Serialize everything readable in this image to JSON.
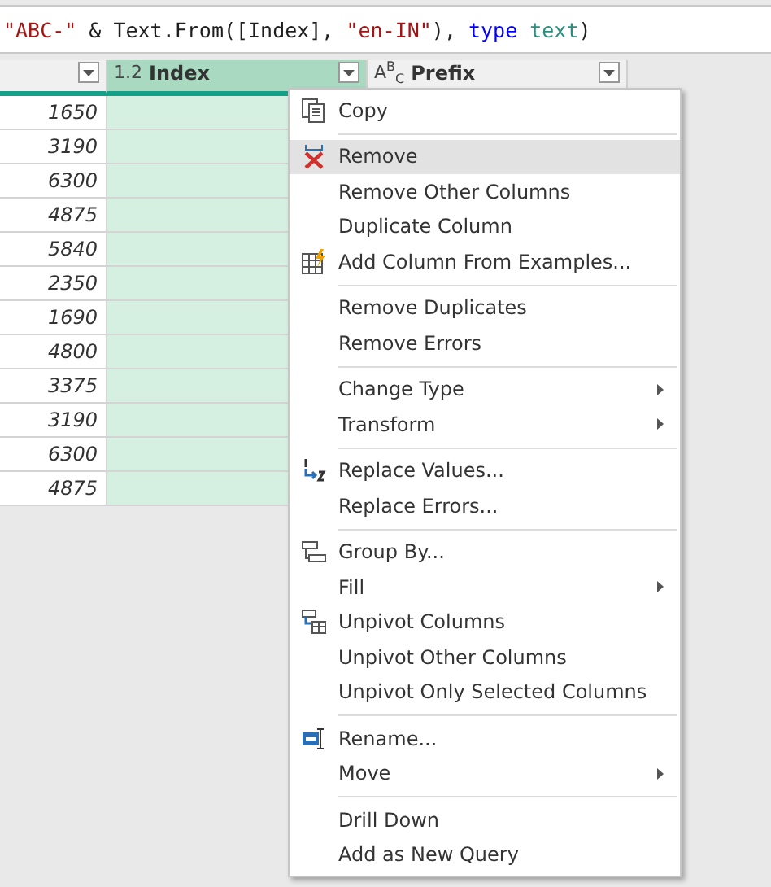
{
  "formula_bar": {
    "parts": [
      {
        "kind": "string",
        "text": "\"ABC-\""
      },
      {
        "kind": "plain",
        "text": " & Text.From([Index], "
      },
      {
        "kind": "string",
        "text": "\"en-IN\""
      },
      {
        "kind": "plain",
        "text": "), "
      },
      {
        "kind": "keyword",
        "text": "type"
      },
      {
        "kind": "type",
        "text": " text"
      },
      {
        "kind": "plain",
        "text": ")"
      }
    ]
  },
  "table": {
    "columns": [
      {
        "selected": false
      },
      {
        "label": "Index",
        "type_label": "1.2",
        "selected": true
      },
      {
        "label": "Prefix",
        "type_label": "A$^{B}$$_{C}$",
        "selected": false
      }
    ],
    "rows": [
      "1650",
      "3190",
      "6300",
      "4875",
      "5840",
      "2350",
      "1690",
      "4800",
      "3375",
      "3190",
      "6300",
      "4875"
    ]
  },
  "context_menu": {
    "groups": [
      [
        {
          "label": "Copy",
          "kind": "copy",
          "submenu": false,
          "selected": false
        }
      ],
      [
        {
          "label": "Remove",
          "kind": "remove",
          "submenu": false,
          "selected": true
        },
        {
          "label": "Remove Other Columns",
          "kind": "plain",
          "submenu": false,
          "selected": false
        },
        {
          "label": "Duplicate Column",
          "kind": "plain",
          "submenu": false,
          "selected": false
        },
        {
          "label": "Add Column From Examples...",
          "kind": "examples",
          "submenu": false,
          "selected": false
        }
      ],
      [
        {
          "label": "Remove Duplicates",
          "kind": "plain",
          "submenu": false,
          "selected": false
        },
        {
          "label": "Remove Errors",
          "kind": "plain",
          "submenu": false,
          "selected": false
        }
      ],
      [
        {
          "label": "Change Type",
          "kind": "plain",
          "submenu": true,
          "selected": false
        },
        {
          "label": "Transform",
          "kind": "plain",
          "submenu": true,
          "selected": false
        }
      ],
      [
        {
          "label": "Replace Values...",
          "kind": "replace",
          "submenu": false,
          "selected": false
        },
        {
          "label": "Replace Errors...",
          "kind": "plain",
          "submenu": false,
          "selected": false
        }
      ],
      [
        {
          "label": "Group By...",
          "kind": "group",
          "submenu": false,
          "selected": false
        },
        {
          "label": "Fill",
          "kind": "plain",
          "submenu": true,
          "selected": false
        },
        {
          "label": "Unpivot Columns",
          "kind": "unpivot",
          "submenu": false,
          "selected": false
        },
        {
          "label": "Unpivot Other Columns",
          "kind": "plain",
          "submenu": false,
          "selected": false
        },
        {
          "label": "Unpivot Only Selected Columns",
          "kind": "plain",
          "submenu": false,
          "selected": false
        }
      ],
      [
        {
          "label": "Rename...",
          "kind": "rename",
          "submenu": false,
          "selected": false
        },
        {
          "label": "Move",
          "kind": "plain",
          "submenu": true,
          "selected": false
        }
      ],
      [
        {
          "label": "Drill Down",
          "kind": "plain",
          "submenu": false,
          "selected": false
        },
        {
          "label": "Add as New Query",
          "kind": "plain",
          "submenu": false,
          "selected": false
        }
      ]
    ]
  }
}
